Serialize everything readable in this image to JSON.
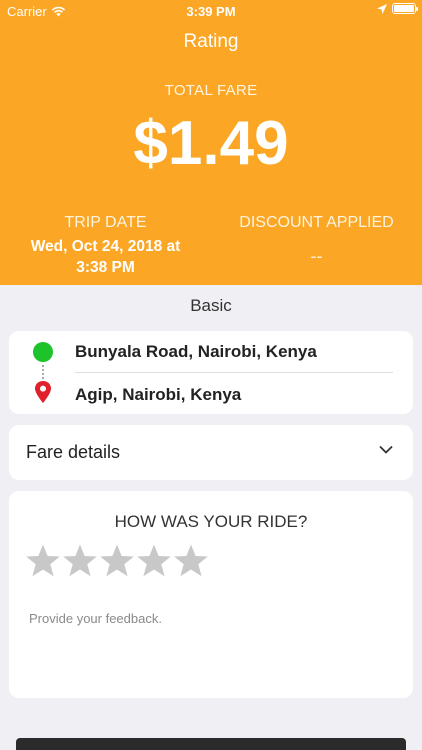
{
  "status_bar": {
    "carrier": "Carrier",
    "time": "3:39 PM"
  },
  "header": {
    "title": "Rating",
    "total_fare_label": "TOTAL FARE",
    "total_fare": "$1.49",
    "trip_date_label": "TRIP DATE",
    "trip_date_line1": "Wed, Oct 24, 2018 at",
    "trip_date_line2": "3:38 PM",
    "discount_label": "DISCOUNT APPLIED",
    "discount_value": "--"
  },
  "vehicle_type": "Basic",
  "route": {
    "pickup": "Bunyala Road, Nairobi, Kenya",
    "dropoff": "Agip,  Nairobi,  Kenya"
  },
  "fare_details_label": "Fare details",
  "rating": {
    "question": "HOW WAS YOUR RIDE?",
    "stars_selected": 0,
    "stars_total": 5,
    "feedback_placeholder": "Provide your feedback."
  },
  "colors": {
    "header_bg": "#fba625",
    "pickup": "#1ec22a",
    "dropoff": "#e0202a",
    "star_empty": "#c8c8c8"
  }
}
